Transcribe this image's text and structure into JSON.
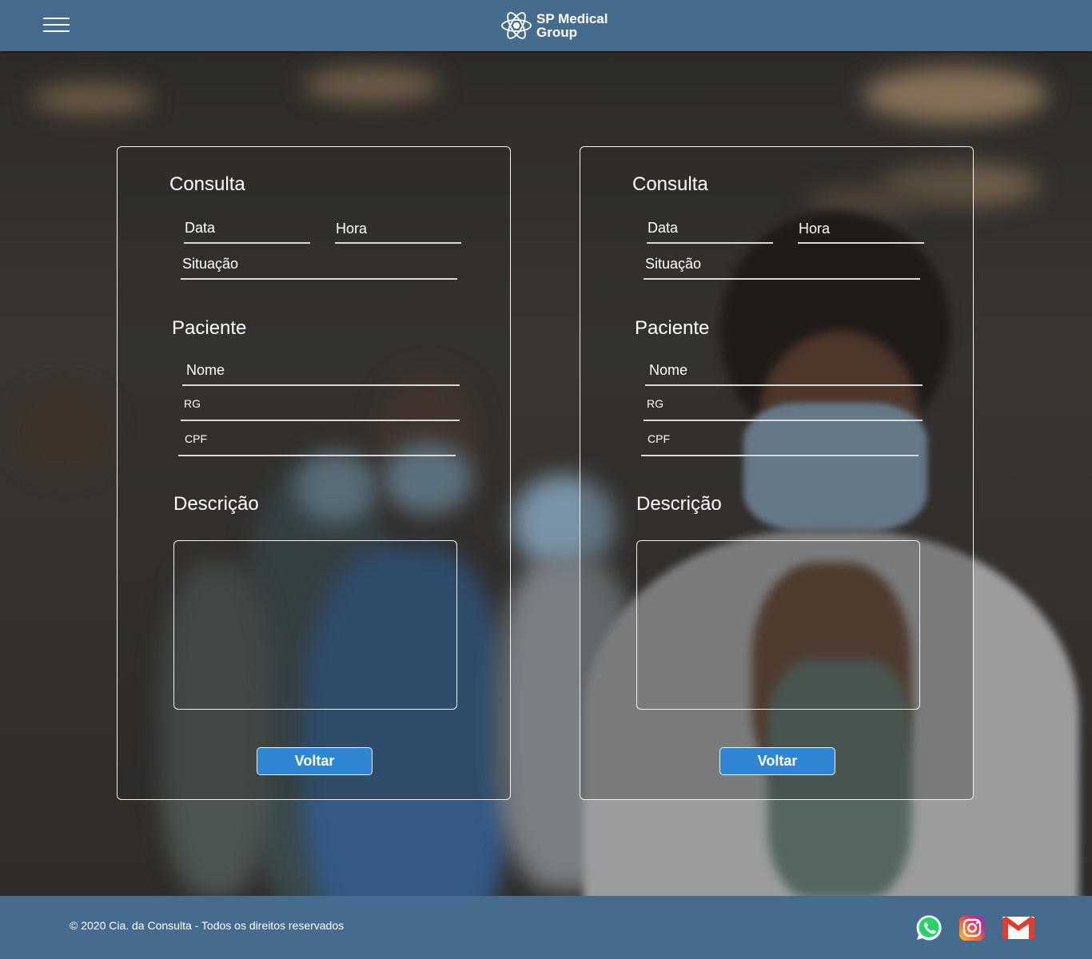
{
  "header": {
    "brand_line1": "SP Medical",
    "brand_line2": "Group"
  },
  "cards": [
    {
      "consulta_title": "Consulta",
      "data_label": "Data",
      "hora_label": "Hora",
      "situacao_label": "Situação",
      "paciente_title": "Paciente",
      "nome_label": "Nome",
      "rg_label": "RG",
      "cpf_label": "CPF",
      "descricao_title": "Descrição",
      "button_label": "Voltar"
    },
    {
      "consulta_title": "Consulta",
      "data_label": "Data",
      "hora_label": "Hora",
      "situacao_label": "Situação",
      "paciente_title": "Paciente",
      "nome_label": "Nome",
      "rg_label": "RG",
      "cpf_label": "CPF",
      "descricao_title": "Descrição",
      "button_label": "Voltar"
    }
  ],
  "footer": {
    "copyright": "© 2020 Cia. da Consulta - Todos os direitos reservados",
    "social": [
      "whatsapp-icon",
      "instagram-icon",
      "gmail-icon"
    ]
  },
  "colors": {
    "bar": "#456c8f",
    "button": "#2f86d4"
  }
}
